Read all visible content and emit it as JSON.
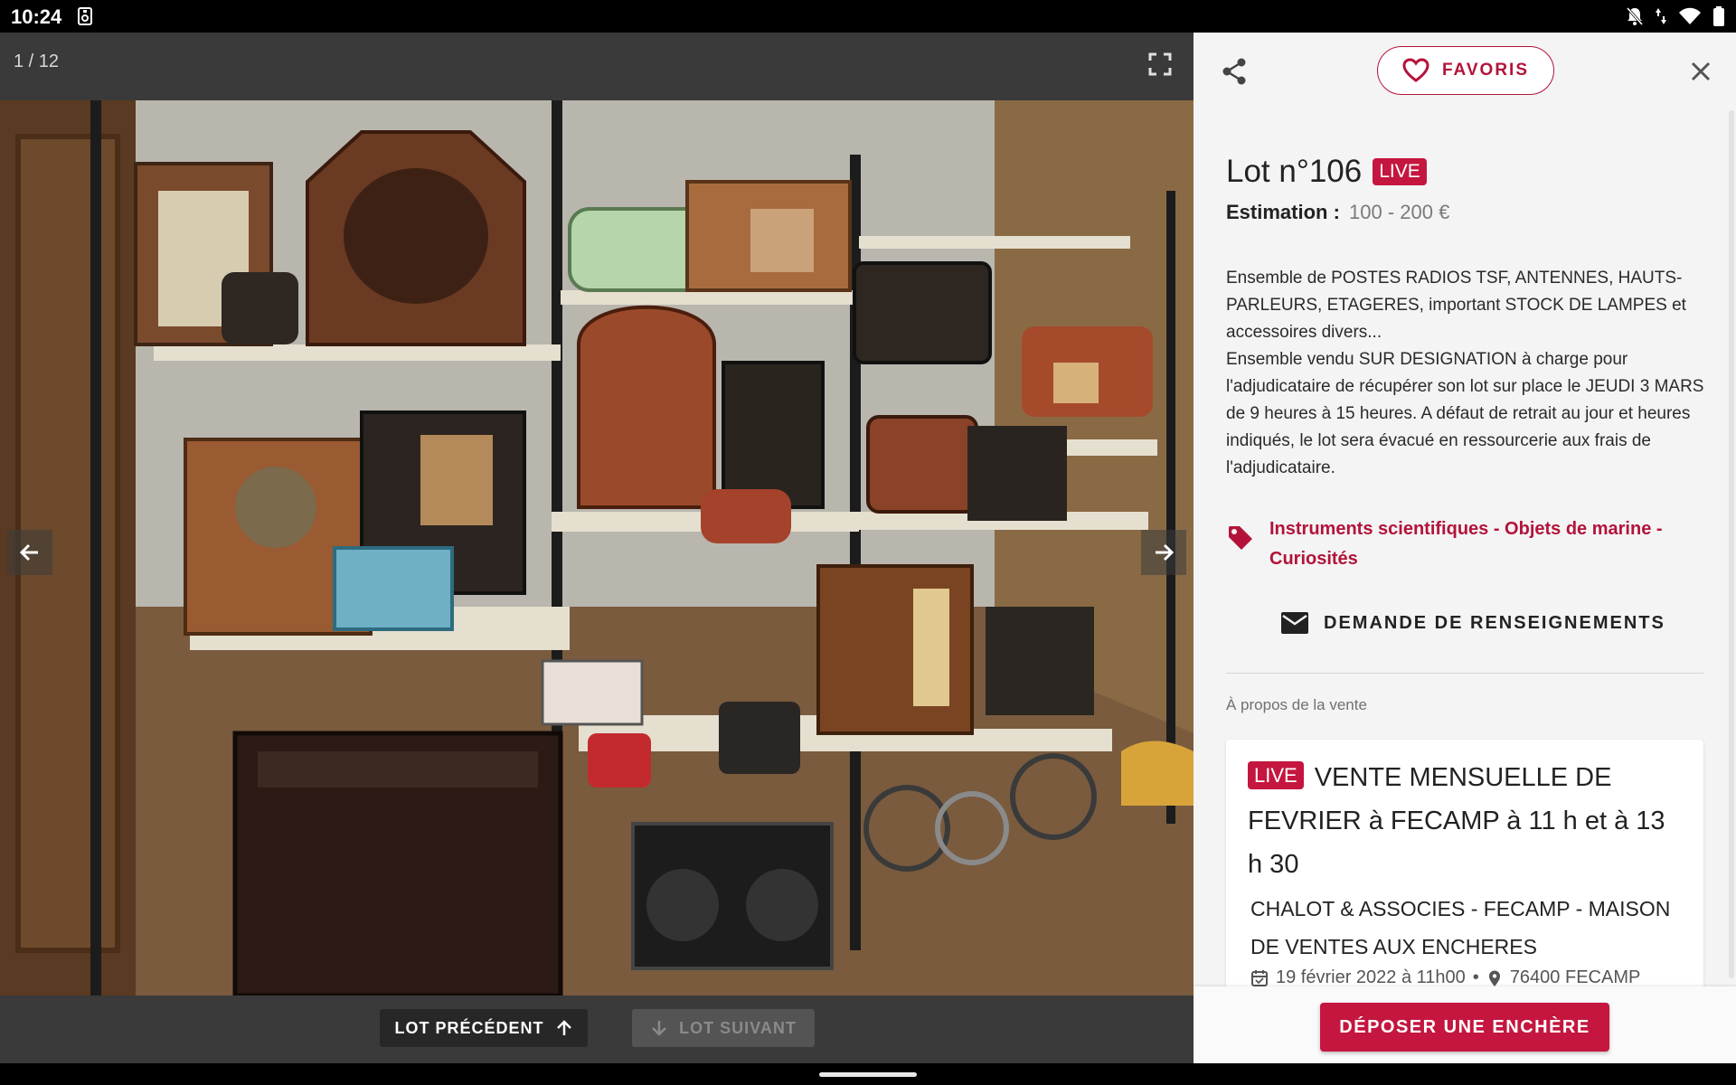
{
  "status_bar": {
    "time": "10:24",
    "icons": [
      "sim-icon",
      "notifications-off-icon",
      "data-arrows-icon",
      "wifi-icon",
      "battery-icon"
    ]
  },
  "gallery": {
    "page_counter": "1 / 12",
    "image_alt": "Étagères garnies de postes radios TSF anciens",
    "prev_button": "LOT PRÉCÉDENT",
    "next_button": "LOT SUIVANT",
    "next_disabled": true
  },
  "detail": {
    "favorite_label": "FAVORIS",
    "lot_title": "Lot n°106",
    "live_label": "LIVE",
    "estimation_label": "Estimation :",
    "estimation_value": "100 - 200 €",
    "description": "Ensemble de POSTES RADIOS TSF, ANTENNES, HAUTS-PARLEURS, ETAGERES, important STOCK DE LAMPES et accessoires divers...\nEnsemble vendu SUR DESIGNATION à charge pour l'adjudicataire de récupérer son lot sur place le JEUDI 3 MARS de 9 heures à 15 heures. A défaut de retrait au jour et heures indiqués, le lot sera évacué en ressourcerie aux frais de l'adjudicataire.",
    "category": "Instruments scientifiques - Objets de marine - Curiosités",
    "info_request": "DEMANDE DE RENSEIGNEMENTS",
    "about_label": "À propos de la vente",
    "sale": {
      "live_label": "LIVE",
      "title": "VENTE MENSUELLE DE FEVRIER à FECAMP à 11 h et à 13 h 30",
      "house": "CHALOT & ASSOCIES - FECAMP - MAISON DE VENTES AUX ENCHERES",
      "date": "19 février 2022 à 11h00",
      "separator": "•",
      "location": "76400 FECAMP"
    },
    "bid_button": "DÉPOSER UNE ENCHÈRE"
  },
  "colors": {
    "accent": "#c4163f",
    "accent_text": "#b3133a",
    "panel_bg": "#f4f4f4",
    "gallery_bg": "#3a3a3a"
  }
}
